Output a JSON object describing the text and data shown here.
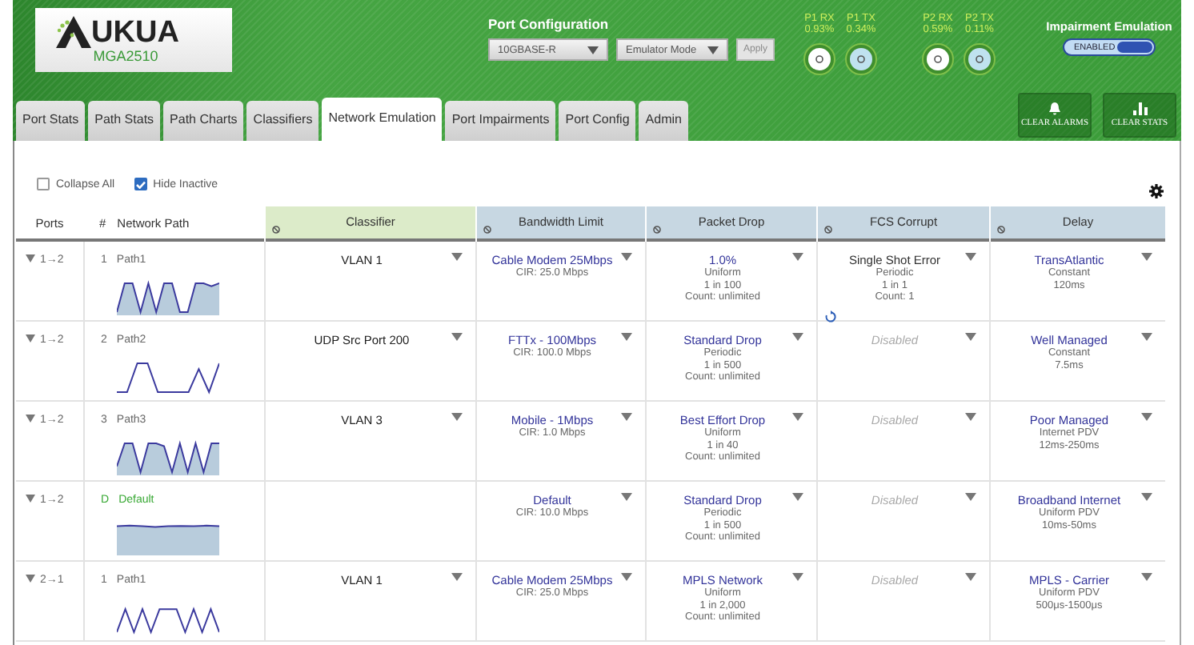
{
  "header": {
    "logo": {
      "name": "UKUA",
      "model": "MGA2510"
    },
    "port_config": {
      "title": "Port Configuration",
      "interface": "10GBASE-R",
      "mode": "Emulator Mode",
      "apply": "Apply",
      "apply_disabled": true
    },
    "meters": [
      {
        "label": "P1 RX",
        "value": "0.93%",
        "kind": "rx"
      },
      {
        "label": "P1 TX",
        "value": "0.34%",
        "kind": "tx"
      },
      {
        "label": "P2 RX",
        "value": "0.59%",
        "kind": "rx"
      },
      {
        "label": "P2 TX",
        "value": "0.11%",
        "kind": "tx"
      }
    ],
    "impairment": {
      "title": "Impairment Emulation",
      "label": "ENABLED",
      "on": true
    },
    "tabs": [
      {
        "label": "Port Stats",
        "selected": false
      },
      {
        "label": "Path Stats",
        "selected": false
      },
      {
        "label": "Path Charts",
        "selected": false
      },
      {
        "label": "Classifiers",
        "selected": false
      },
      {
        "label": "Network Emulation",
        "selected": true
      },
      {
        "label": "Port Impairments",
        "selected": false
      },
      {
        "label": "Port Config",
        "selected": false
      },
      {
        "label": "Admin",
        "selected": false
      }
    ],
    "actions": [
      {
        "label": "CLEAR ALARMS",
        "kind": "alarms"
      },
      {
        "label": "CLEAR STATS",
        "kind": "stats"
      }
    ]
  },
  "options": [
    {
      "label": "Collapse All",
      "checked": false
    },
    {
      "label": "Hide Inactive",
      "checked": true
    }
  ],
  "table": {
    "columns": [
      {
        "label": "Ports"
      },
      {
        "label": "#"
      },
      {
        "label": "Network Path"
      },
      {
        "label": "Classifier",
        "color": "#dcebc9"
      },
      {
        "label": "Bandwidth Limit",
        "color": "#c7d7e2"
      },
      {
        "label": "Packet Drop",
        "color": "#c7d7e2"
      },
      {
        "label": "FCS Corrupt",
        "color": "#c7d7e2"
      },
      {
        "label": "Delay",
        "color": "#c7d7e2"
      }
    ],
    "rows": [
      {
        "ports": "1→2",
        "expanded": true,
        "number": "1",
        "path": "Path1",
        "kind": "path",
        "classifier": "VLAN 1",
        "bandwidth": {
          "title": "Cable Modem 25Mbps",
          "lines": [
            "CIR: 25.0 Mbps"
          ]
        },
        "drop": {
          "title": "1.0%",
          "lines": [
            "Uniform",
            "1 in 100",
            "Count: unlimited"
          ]
        },
        "fcs": {
          "title": "Single Shot Error",
          "lines": [
            "Periodic",
            "1 in 1",
            "Count: 1"
          ],
          "disabled": false,
          "resettable": true
        },
        "delay": {
          "title": "TransAtlantic",
          "lines": [
            "Constant",
            "120ms"
          ]
        }
      },
      {
        "ports": "1→2",
        "expanded": true,
        "number": "2",
        "path": "Path2",
        "kind": "path",
        "classifier": "UDP Src Port 200",
        "bandwidth": {
          "title": "FTTx - 100Mbps",
          "lines": [
            "CIR: 100.0 Mbps"
          ]
        },
        "drop": {
          "title": "Standard Drop",
          "lines": [
            "Periodic",
            "1 in 500",
            "Count: unlimited"
          ]
        },
        "fcs": {
          "title": "Disabled",
          "disabled": true,
          "resettable": false
        },
        "delay": {
          "title": "Well Managed",
          "lines": [
            "Constant",
            "7.5ms"
          ]
        }
      },
      {
        "ports": "1→2",
        "expanded": true,
        "number": "3",
        "path": "Path3",
        "kind": "path",
        "classifier": "VLAN 3",
        "bandwidth": {
          "title": "Mobile - 1Mbps",
          "lines": [
            "CIR: 1.0 Mbps"
          ]
        },
        "drop": {
          "title": "Best Effort Drop",
          "lines": [
            "Uniform",
            "1 in 40",
            "Count: unlimited"
          ]
        },
        "fcs": {
          "title": "Disabled",
          "disabled": true,
          "resettable": false
        },
        "delay": {
          "title": "Poor Managed",
          "lines": [
            "Internet PDV",
            "12ms-250ms"
          ]
        }
      },
      {
        "ports": "1→2",
        "expanded": true,
        "number": "D",
        "path": "Default",
        "kind": "default",
        "bandwidth": {
          "title": "Default",
          "lines": [
            "CIR: 10.0 Mbps"
          ]
        },
        "drop": {
          "title": "Standard Drop",
          "lines": [
            "Periodic",
            "1 in 500",
            "Count: unlimited"
          ]
        },
        "fcs": {
          "title": "Disabled",
          "disabled": true,
          "resettable": false
        },
        "delay": {
          "title": "Broadband Internet",
          "lines": [
            "Uniform PDV",
            "10ms-50ms"
          ]
        }
      },
      {
        "ports": "2→1",
        "expanded": true,
        "number": "1",
        "path": "Path1",
        "kind": "path",
        "classifier": "VLAN 1",
        "bandwidth": {
          "title": "Cable Modem 25Mbps",
          "lines": [
            "CIR: 25.0 Mbps"
          ]
        },
        "drop": {
          "title": "MPLS Network",
          "lines": [
            "Uniform",
            "1 in 2,000",
            "Count: unlimited"
          ]
        },
        "fcs": {
          "title": "Disabled",
          "disabled": true,
          "resettable": false
        },
        "delay": {
          "title": "MPLS - Carrier",
          "lines": [
            "Uniform PDV",
            "500μs-1500μs"
          ]
        }
      }
    ]
  }
}
